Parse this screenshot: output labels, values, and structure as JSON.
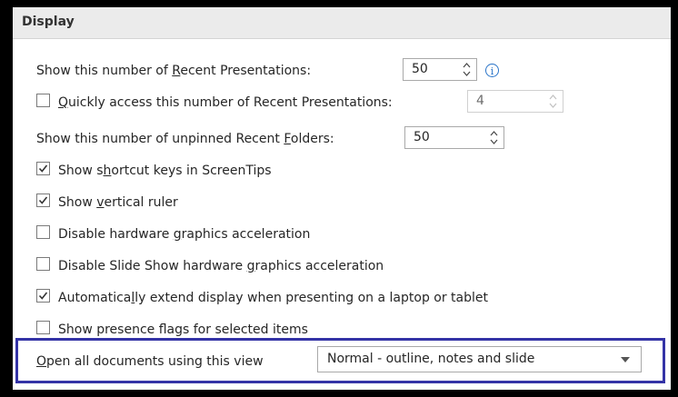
{
  "section": {
    "title": "Display"
  },
  "recent_presentations": {
    "pre": "Show this number of ",
    "u": "R",
    "post": "ecent Presentations:",
    "value": "50"
  },
  "quick_access": {
    "u": "Q",
    "post": "uickly access this number of Recent Presentations:",
    "value": "4",
    "checked": false
  },
  "recent_folders": {
    "pre": "Show this number of unpinned Recent ",
    "u": "F",
    "post": "olders:",
    "value": "50"
  },
  "options": [
    {
      "pre": "Show s",
      "u": "h",
      "post": "ortcut keys in ScreenTips",
      "checked": true
    },
    {
      "pre": "Show ",
      "u": "v",
      "post": "ertical ruler",
      "checked": true
    },
    {
      "pre": "Disable hardware ",
      "u": "g",
      "post": "raphics acceleration",
      "checked": false
    },
    {
      "pre": "Disable Slide Show hardware ",
      "u": "g",
      "post": "raphics acceleration",
      "checked": false
    },
    {
      "pre": "Automatica",
      "u": "l",
      "post": "ly extend display when presenting on a laptop or tablet",
      "checked": true
    },
    {
      "pre": "Show presence flags for selected items",
      "u": "",
      "post": "",
      "checked": false
    }
  ],
  "open_view": {
    "pre": "",
    "u": "O",
    "post": "pen all documents using this view",
    "value": "Normal - outline, notes and slide"
  },
  "icons": {
    "info": "info-icon",
    "spin": "spinner-arrows-icon",
    "check": "checkmark-icon",
    "caret": "chevron-down-icon"
  }
}
